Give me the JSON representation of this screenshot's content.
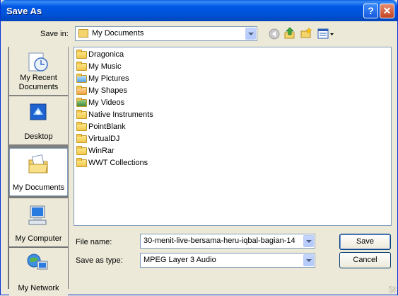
{
  "window": {
    "title": "Save As",
    "help_glyph": "?",
    "close_glyph": "✕"
  },
  "save_in": {
    "label": "Save in:",
    "value": "My Documents"
  },
  "toolbar": {
    "icons": [
      "back-icon",
      "up-folder-icon",
      "new-folder-icon",
      "view-menu-icon"
    ]
  },
  "places": [
    {
      "label": "My Recent Documents",
      "icon": "recent-documents-icon"
    },
    {
      "label": "Desktop",
      "icon": "desktop-icon"
    },
    {
      "label": "My Documents",
      "icon": "my-documents-icon",
      "selected": true
    },
    {
      "label": "My Computer",
      "icon": "my-computer-icon"
    },
    {
      "label": "My Network",
      "icon": "my-network-icon"
    }
  ],
  "files": [
    {
      "name": "Dragonica",
      "icon": "folder-icon"
    },
    {
      "name": "My Music",
      "icon": "music-folder-icon"
    },
    {
      "name": "My Pictures",
      "icon": "pictures-folder-icon"
    },
    {
      "name": "My Shapes",
      "icon": "shapes-folder-icon"
    },
    {
      "name": "My Videos",
      "icon": "videos-folder-icon"
    },
    {
      "name": "Native Instruments",
      "icon": "folder-icon"
    },
    {
      "name": "PointBlank",
      "icon": "folder-icon"
    },
    {
      "name": "VirtualDJ",
      "icon": "folder-icon"
    },
    {
      "name": "WinRar",
      "icon": "folder-icon"
    },
    {
      "name": "WWT Collections",
      "icon": "folder-icon"
    }
  ],
  "file_name": {
    "label": "File name:",
    "value": "30-menit-live-bersama-heru-iqbal-bagian-14"
  },
  "save_as_type": {
    "label": "Save as type:",
    "value": "MPEG Layer 3 Audio"
  },
  "buttons": {
    "save": "Save",
    "cancel": "Cancel"
  },
  "colors": {
    "titlebar": "#0054e3",
    "dialog_bg": "#ece9d8",
    "places_bg": "#7b7b7b"
  }
}
